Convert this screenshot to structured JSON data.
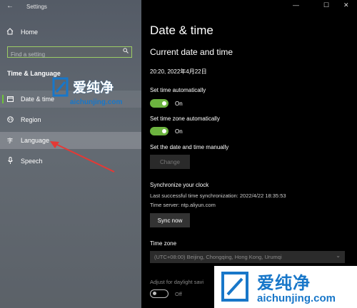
{
  "window": {
    "title": "Settings",
    "minimize": "—",
    "maximize": "☐",
    "close": "✕"
  },
  "sidebar": {
    "home": "Home",
    "search_placeholder": "Find a setting",
    "section_title": "Time & Language",
    "items": [
      {
        "label": "Date & time",
        "icon": "calendar-icon"
      },
      {
        "label": "Region",
        "icon": "globe-icon"
      },
      {
        "label": "Language",
        "icon": "language-icon"
      },
      {
        "label": "Speech",
        "icon": "microphone-icon"
      }
    ]
  },
  "main": {
    "title": "Date & time",
    "section_current": "Current date and time",
    "current_datetime": "20:20, 2022年4月22日",
    "set_time_auto_label": "Set time automatically",
    "set_time_auto_state": "On",
    "set_timezone_auto_label": "Set time zone automatically",
    "set_timezone_auto_state": "On",
    "set_manual_label": "Set the date and time manually",
    "change_button": "Change",
    "sync_title": "Synchronize your clock",
    "last_sync": "Last successful time synchronization: 2022/4/22 18:35:53",
    "time_server": "Time server: ntp.aliyun.com",
    "sync_button": "Sync now",
    "timezone_title": "Time zone",
    "timezone_value": "(UTC+08:00) Beijing, Chongqing, Hong Kong, Urumqi",
    "daylight_label": "Adjust for daylight savi",
    "daylight_state": "Off"
  },
  "watermark": {
    "name": "爱纯净",
    "url": "aichunjing.com"
  },
  "colors": {
    "accent_green": "#6cb33f",
    "watermark_blue": "#1877c9",
    "arrow_red": "#e53935"
  }
}
